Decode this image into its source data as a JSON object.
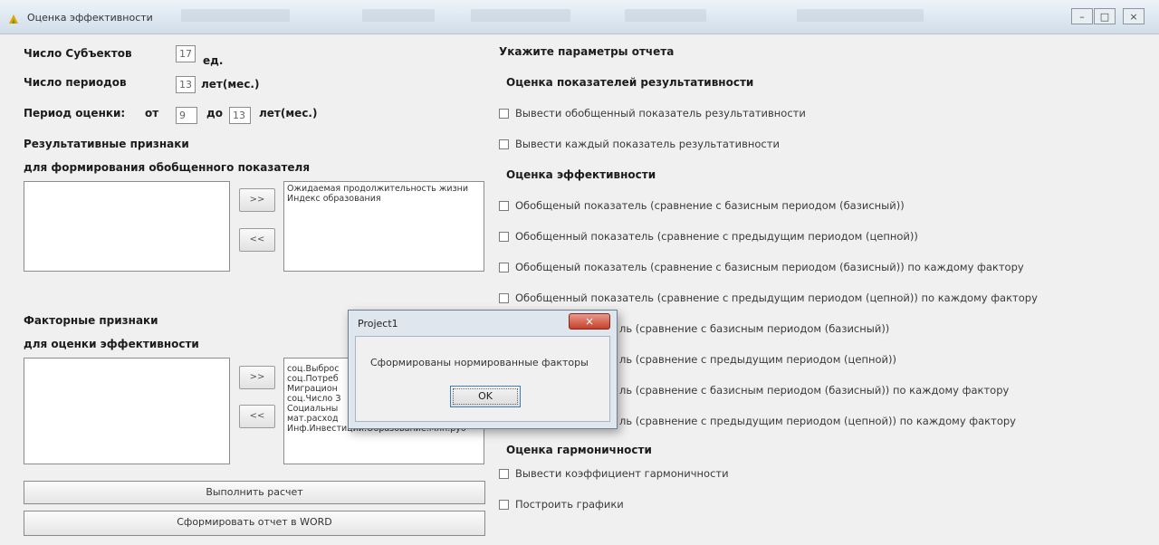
{
  "window": {
    "title": "Оценка эффективности",
    "controls": {
      "minimize": "–",
      "maximize": "□",
      "close": "×"
    }
  },
  "left": {
    "subjects_label": "Число Субъектов",
    "subjects_value": "17",
    "subjects_unit": "ед.",
    "periods_label": "Число периодов",
    "periods_value": "13",
    "periods_unit": "лет(мес.)",
    "eval_period_label": "Период оценки:",
    "from_label": "от",
    "from_value": "9",
    "to_label": "до",
    "to_value": "13",
    "eval_unit": "лет(мес.)",
    "result_title": "Результативные признаки",
    "result_subtitle": "для формирования обобщенного показателя",
    "result_selected": [
      "Ожидаемая продолжительность жизни",
      "Индекс образования"
    ],
    "factor_title": "Факторные  признаки",
    "factor_subtitle": "для оценки эффективности",
    "factor_selected": [
      "соц.Выброс",
      "соц.Потреб",
      "Миграцион",
      "соц.Число З",
      "Социальны",
      "мат.расход",
      "Инф.Инвестиции.Образование.Млн.руб"
    ],
    "add_btn": ">>",
    "remove_btn": "<<",
    "calc_btn": "Выполнить расчет",
    "report_btn": "Сформировать отчет в WORD"
  },
  "right": {
    "header": "Укажите параметры отчета",
    "section_results": "Оценка показателей результативности",
    "results_options": [
      "Вывести обобщенный показатель результативности",
      "Вывести каждый показатель результативности"
    ],
    "section_efficiency": "Оценка эффективности",
    "efficiency_options": [
      "Обобщеный показатель (сравнение с базисным периодом (базисный))",
      "Обобщенный показатель (сравнение с предыдущим периодом (цепной))",
      "Обобщеный показатель (сравнение с базисным периодом (базисный)) по каждому фактору",
      "Обобщенный показатель (сравнение с предыдущим периодом (цепной)) по каждому фактору",
      "ль (сравнение с базисным периодом (базисный))",
      "ль (сравнение с предыдущим периодом (цепной))",
      "ль (сравнение с базисным периодом (базисный)) по каждому фактору",
      "ль (сравнение с предыдущим периодом (цепной)) по каждому фактору"
    ],
    "section_harmony": "Оценка гармоничности",
    "harmony_options": [
      "Вывести коэффициент гармоничности",
      "Построить графики"
    ]
  },
  "dialog": {
    "title": "Project1",
    "message": "Сформированы нормированные факторы",
    "ok": "OK",
    "close": "×"
  }
}
